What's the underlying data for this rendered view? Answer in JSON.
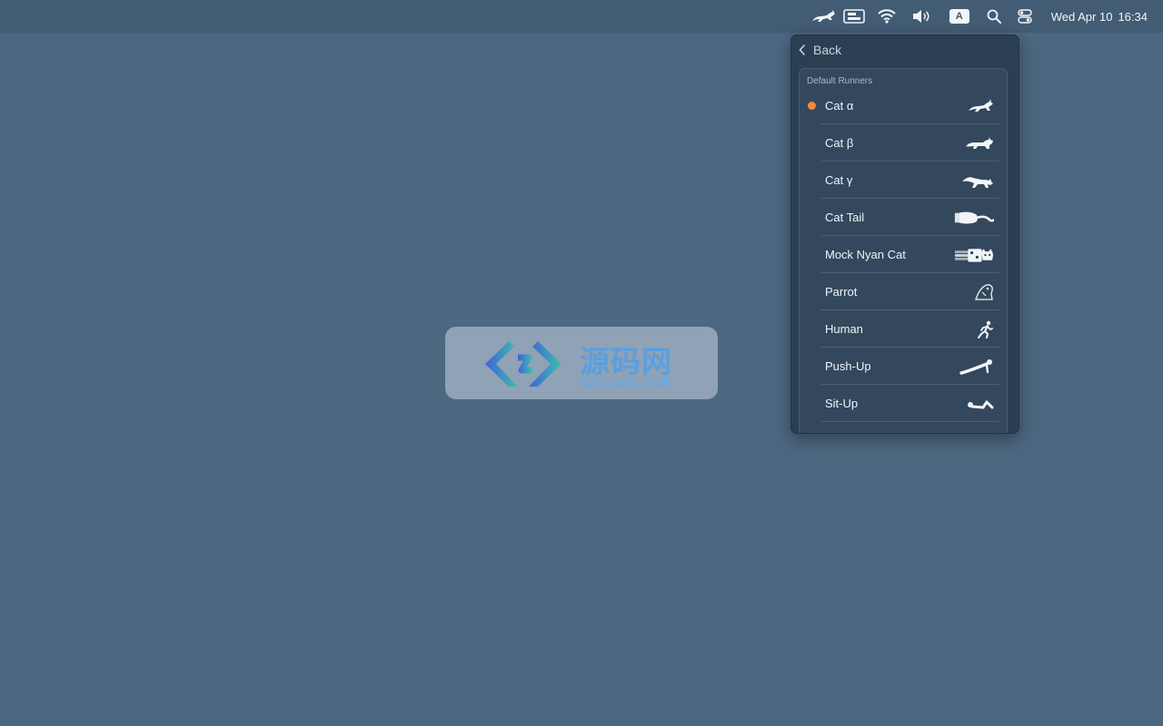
{
  "menubar": {
    "date": "Wed Apr 10",
    "time": "16:34",
    "input_source": "A",
    "icons": [
      "runcat-icon",
      "screen-mirror-icon",
      "wifi-icon",
      "volume-icon",
      "input-source-icon",
      "spotlight-search-icon",
      "control-center-icon"
    ]
  },
  "panel": {
    "back_label": "Back",
    "group_title": "Default Runners",
    "accent_color": "#f08a3a",
    "runners": [
      {
        "label": "Cat α",
        "icon": "cat-alpha-icon",
        "selected": true
      },
      {
        "label": "Cat β",
        "icon": "cat-beta-icon",
        "selected": false
      },
      {
        "label": "Cat γ",
        "icon": "cat-gamma-icon",
        "selected": false
      },
      {
        "label": "Cat Tail",
        "icon": "cat-tail-icon",
        "selected": false
      },
      {
        "label": "Mock Nyan Cat",
        "icon": "nyan-cat-icon",
        "selected": false
      },
      {
        "label": "Parrot",
        "icon": "parrot-icon",
        "selected": false
      },
      {
        "label": "Human",
        "icon": "human-running-icon",
        "selected": false
      },
      {
        "label": "Push-Up",
        "icon": "push-up-icon",
        "selected": false
      },
      {
        "label": "Sit-Up",
        "icon": "sit-up-icon",
        "selected": false
      }
    ]
  },
  "watermark": {
    "title": "源码网",
    "subtitle": "52scode.CoM"
  }
}
